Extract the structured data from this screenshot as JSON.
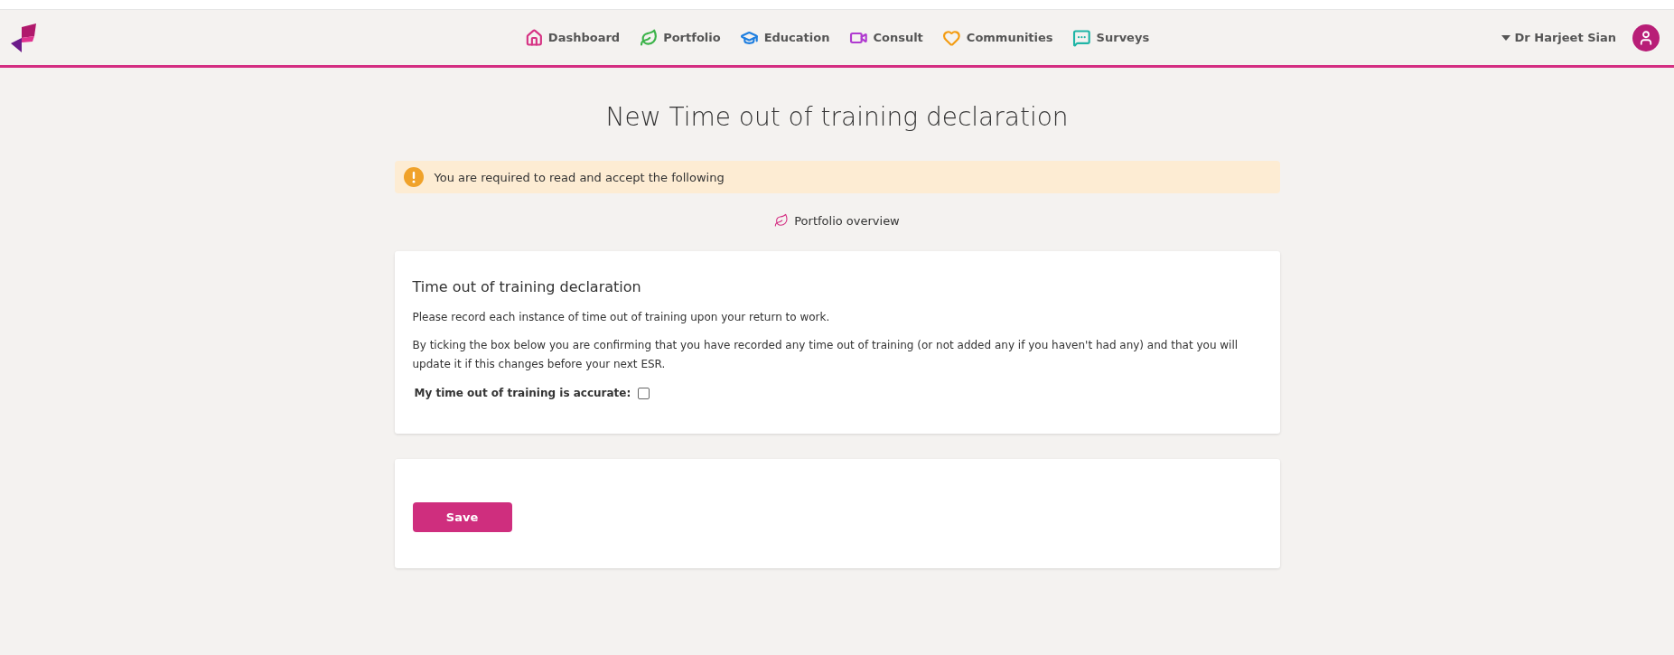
{
  "nav": {
    "items": [
      {
        "label": "Dashboard",
        "kind": "home",
        "color": "#d63384"
      },
      {
        "label": "Portfolio",
        "kind": "leaf",
        "color": "#3cb34a"
      },
      {
        "label": "Education",
        "kind": "graduation",
        "color": "#1f7fe0"
      },
      {
        "label": "Consult",
        "kind": "video",
        "color": "#b03bd0"
      },
      {
        "label": "Communities",
        "kind": "heart",
        "color": "#f39c12"
      },
      {
        "label": "Surveys",
        "kind": "chat",
        "color": "#1fb5a6"
      }
    ]
  },
  "user": {
    "name": "Dr Harjeet Sian"
  },
  "page": {
    "title": "New Time out of training declaration"
  },
  "alert": {
    "text": "You are required to read and accept the following"
  },
  "breadcrumb": {
    "label": "Portfolio overview"
  },
  "declaration": {
    "title": "Time out of training declaration",
    "paragraphs": [
      "Please record each instance of time out of training upon your return to work.",
      "By ticking the box below you are confirming that you have recorded any time out of training (or not added any if you haven't had any) and that you will update it if this changes before your next ESR."
    ],
    "checkbox": {
      "label": "My time out of training is accurate:",
      "checked": false
    }
  },
  "actions": {
    "save": "Save"
  }
}
